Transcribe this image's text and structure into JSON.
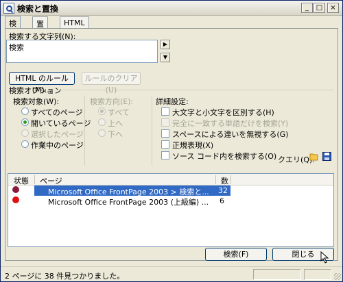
{
  "window": {
    "title": "検索と置換"
  },
  "window_buttons": {
    "minimize": "_",
    "maximize": "□",
    "close": "×"
  },
  "tabs": [
    {
      "label": "検索"
    },
    {
      "label": "置換"
    },
    {
      "label": "HTML タグ"
    }
  ],
  "search": {
    "label": "検索する文字列(N):",
    "value": "検索"
  },
  "buttons": {
    "html_rules": "HTML のルール(M)...",
    "clear_rules": "ルールのクリア(U)",
    "search": "検索(F)",
    "close": "閉じる"
  },
  "options": {
    "group_label": "検索オプション",
    "target_label": "検索対象(W):",
    "targets": [
      "すべてのページ",
      "開いているページ",
      "選択したページ",
      "作業中のページ"
    ],
    "direction_label": "検索方向(E):",
    "directions": [
      "すべて",
      "上へ",
      "下へ"
    ],
    "advanced_label": "詳細設定:",
    "advanced": [
      "大文字と小文字を区別する(H)",
      "完全に一致する単語だけを検索(Y)",
      "スペースによる違いを無視する(G)",
      "正規表現(X)",
      "ソース コード内を検索する(O)"
    ],
    "query_label": "クエリ(Q):"
  },
  "results": {
    "columns": [
      "状態",
      "ページ",
      "数"
    ],
    "rows": [
      {
        "status_color": "#8b1a3a",
        "page": "Microsoft Office FrontPage 2003 > 検索と...",
        "count": "32"
      },
      {
        "status_color": "#e01010",
        "page": "Microsoft Office FrontPage 2003 (上級編) ...",
        "count": "6"
      }
    ]
  },
  "statusbar": {
    "text": "2 ページに 38 件見つかりました。"
  },
  "colors": {
    "selected_row": "#316ac5",
    "title_border": "#0a246a"
  },
  "icons": [
    "search-icon",
    "open-folder-icon",
    "save-icon",
    "arrow-right-icon",
    "arrow-down-icon"
  ]
}
